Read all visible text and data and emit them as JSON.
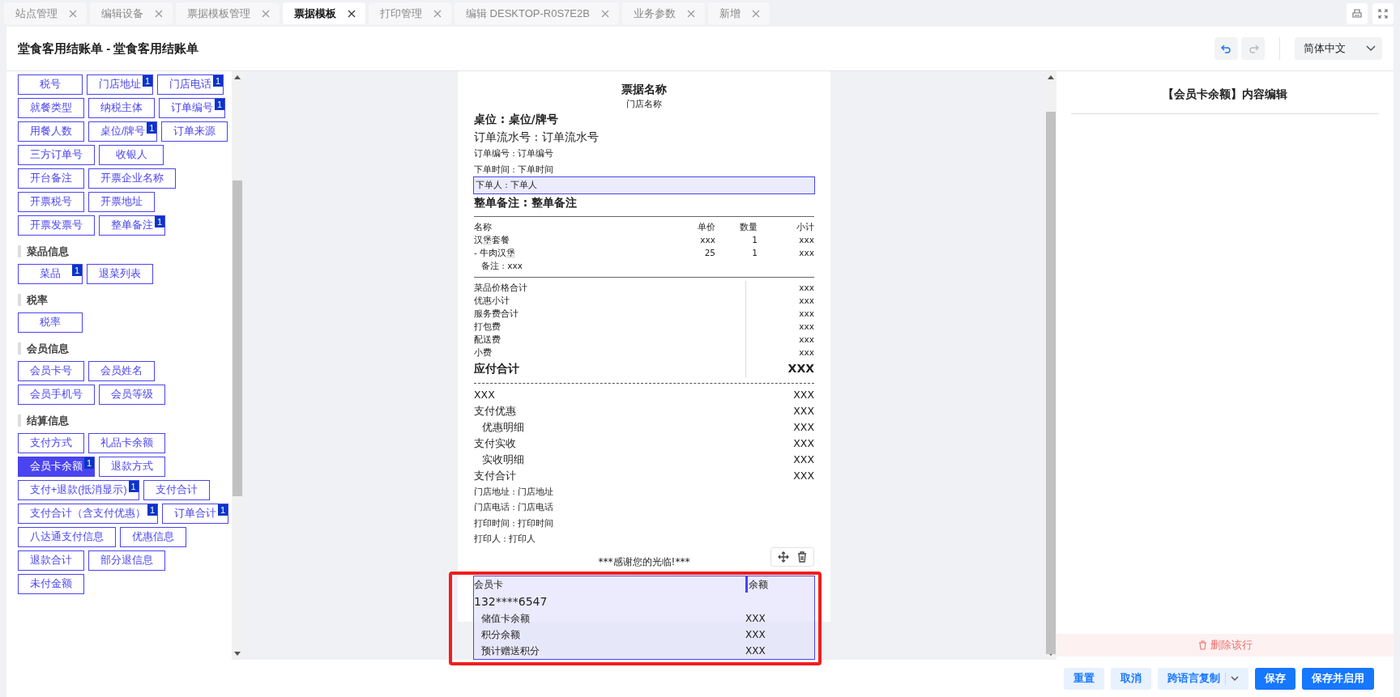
{
  "tabs": [
    {
      "label": "站点管理",
      "selected": false
    },
    {
      "label": "编辑设备",
      "selected": false
    },
    {
      "label": "票据模板管理",
      "selected": false
    },
    {
      "label": "票据模板",
      "selected": true
    },
    {
      "label": "打印管理",
      "selected": false
    },
    {
      "label": "编辑 DESKTOP-R0S7E2B",
      "selected": false
    },
    {
      "label": "业务参数",
      "selected": false
    },
    {
      "label": "新增",
      "selected": false
    }
  ],
  "header": {
    "title": "堂食客用结账单 - 堂食客用结账单",
    "undo": {
      "disabled": false
    },
    "redo": {
      "disabled": true
    },
    "language": "简体中文"
  },
  "field_groups": [
    {
      "items": [
        {
          "label": "税号",
          "selected": false
        },
        {
          "label": "门店地址",
          "badge": "1",
          "selected": false
        },
        {
          "label": "门店电话",
          "badge": "1",
          "selected": false
        },
        {
          "label": "就餐类型",
          "selected": false
        },
        {
          "label": "纳税主体",
          "selected": false
        },
        {
          "label": "订单编号",
          "badge": "1",
          "selected": false
        },
        {
          "label": "用餐人数",
          "selected": false
        },
        {
          "label": "桌位/牌号",
          "badge": "1",
          "selected": false
        },
        {
          "label": "订单来源",
          "selected": false
        },
        {
          "label": "三方订单号",
          "selected": false
        },
        {
          "label": "收银人",
          "selected": false
        },
        {
          "label": "开台备注",
          "selected": false
        },
        {
          "label": "开票企业名称",
          "selected": false
        },
        {
          "label": "开票税号",
          "selected": false
        },
        {
          "label": "开票地址",
          "selected": false
        },
        {
          "label": "开票发票号",
          "selected": false
        },
        {
          "label": "整单备注",
          "badge": "1",
          "selected": false
        }
      ]
    },
    {
      "title": "菜品信息",
      "items": [
        {
          "label": "菜品",
          "badge": "1",
          "selected": false
        },
        {
          "label": "退菜列表",
          "selected": false
        }
      ]
    },
    {
      "title": "税率",
      "items": [
        {
          "label": "税率",
          "selected": false
        }
      ]
    },
    {
      "title": "会员信息",
      "items": [
        {
          "label": "会员卡号",
          "selected": false
        },
        {
          "label": "会员姓名",
          "selected": false
        },
        {
          "label": "会员手机号",
          "selected": false
        },
        {
          "label": "会员等级",
          "selected": false
        }
      ]
    },
    {
      "title": "结算信息",
      "items": [
        {
          "label": "支付方式",
          "selected": false
        },
        {
          "label": "礼品卡余额",
          "selected": false
        },
        {
          "label": "会员卡余额",
          "badge": "1",
          "selected": true
        },
        {
          "label": "退款方式",
          "selected": false
        },
        {
          "label": "支付+退款(抵消显示)",
          "badge": "1",
          "selected": false
        },
        {
          "label": "支付合计",
          "selected": false
        },
        {
          "label": "支付合计（含支付优惠）",
          "badge": "1",
          "selected": false
        },
        {
          "label": "订单合计",
          "badge": "1",
          "selected": false
        },
        {
          "label": "八达通支付信息",
          "selected": false
        },
        {
          "label": "优惠信息",
          "selected": false
        },
        {
          "label": "退款合计",
          "selected": false
        },
        {
          "label": "部分退信息",
          "selected": false
        },
        {
          "label": "未付金额",
          "selected": false
        }
      ]
    }
  ],
  "receipt": {
    "title": "票据名称",
    "store_name": "门店名称",
    "header_fields": [
      {
        "text": "桌位 : 桌位/牌号",
        "kind": "heading",
        "selected": false
      },
      {
        "text": "订单流水号 : 订单流水号",
        "kind": "large",
        "selected": false
      },
      {
        "text": "订单编号 : 订单编号",
        "kind": "small",
        "selected": false
      },
      {
        "text": "下单时间 : 下单时间",
        "kind": "small",
        "selected": false
      },
      {
        "text": "下单人 : 下单人",
        "kind": "small",
        "selected": true
      },
      {
        "text": "整单备注 : 整单备注",
        "kind": "heading",
        "selected": false
      }
    ],
    "items_table": {
      "columns": [
        "名称",
        "单价",
        "数量",
        "小计"
      ],
      "rows": [
        {
          "cells": [
            "汉堡套餐",
            "xxx",
            "1",
            "xxx"
          ]
        },
        {
          "cells": [
            "- 牛肉汉堡",
            "25",
            "1",
            "xxx"
          ]
        }
      ],
      "note": "备注 : xxx"
    },
    "summary": [
      {
        "label": "菜品价格合计",
        "value": "xxx",
        "emphasis": false
      },
      {
        "label": "优惠小计",
        "value": "xxx",
        "emphasis": false
      },
      {
        "label": "服务费合计",
        "value": "xxx",
        "emphasis": false
      },
      {
        "label": "打包费",
        "value": "xxx",
        "emphasis": false
      },
      {
        "label": "配送费",
        "value": "xxx",
        "emphasis": false
      },
      {
        "label": "小费",
        "value": "xxx",
        "emphasis": false
      },
      {
        "label": "应付合计",
        "value": "XXX",
        "emphasis": true
      }
    ],
    "payments": [
      {
        "label": "XXX",
        "value": "XXX",
        "indent": false
      },
      {
        "label": "支付优惠",
        "value": "XXX",
        "indent": false
      },
      {
        "label": "优惠明细",
        "value": "XXX",
        "indent": true
      },
      {
        "label": "支付实收",
        "value": "XXX",
        "indent": false
      },
      {
        "label": "实收明细",
        "value": "XXX",
        "indent": true
      },
      {
        "label": "支付合计",
        "value": "XXX",
        "indent": false
      }
    ],
    "footer_fields": [
      "门店地址 : 门店地址",
      "门店电话 : 门店电话",
      "打印时间 : 打印时间",
      "打印人 : 打印人"
    ],
    "thanks": "***感谢您的光临!***",
    "member_block": {
      "selected": true,
      "columns": [
        "会员卡",
        "余额"
      ],
      "phone": "132****6547",
      "rows": [
        {
          "label": "储值卡余额",
          "value": "XXX"
        },
        {
          "label": "积分余额",
          "value": "XXX"
        },
        {
          "label": "预计赠送积分",
          "value": "XXX"
        }
      ]
    }
  },
  "editor": {
    "title": "【会员卡余额】内容编辑",
    "delete_label": "删除该行"
  },
  "footer_buttons": [
    {
      "label": "重置",
      "kind": "secondary"
    },
    {
      "label": "取消",
      "kind": "secondary"
    },
    {
      "label": "跨语言复制",
      "kind": "dropdown"
    },
    {
      "label": "保存",
      "kind": "primary"
    },
    {
      "label": "保存并启用",
      "kind": "primary"
    }
  ]
}
